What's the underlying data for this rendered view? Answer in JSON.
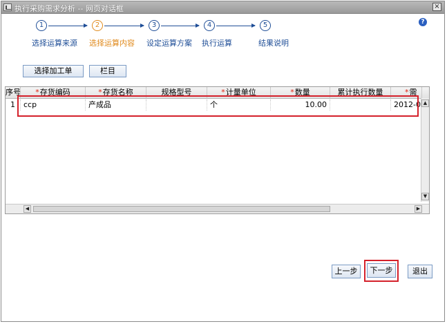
{
  "window": {
    "title": "执行采购需求分析 -- 网页对话框",
    "close_glyph": "×",
    "help_glyph": "?"
  },
  "steps": [
    {
      "number": "1",
      "label": "选择运算来源",
      "active": false
    },
    {
      "number": "2",
      "label": "选择运算内容",
      "active": true
    },
    {
      "number": "3",
      "label": "设定运算方案",
      "active": false
    },
    {
      "number": "4",
      "label": "执行运算",
      "active": false
    },
    {
      "number": "5",
      "label": "结果说明",
      "active": false
    }
  ],
  "toolbar": {
    "select_workorder_label": "选择加工单",
    "columns_label": "栏目"
  },
  "grid": {
    "columns": [
      {
        "label": "序号",
        "required": false
      },
      {
        "label": "存货编码",
        "required": true
      },
      {
        "label": "存货名称",
        "required": true
      },
      {
        "label": "规格型号",
        "required": false
      },
      {
        "label": "计量单位",
        "required": true
      },
      {
        "label": "数量",
        "required": true
      },
      {
        "label": "累计执行数量",
        "required": false
      },
      {
        "label": "需",
        "required": true
      }
    ],
    "rows": [
      {
        "seq": "1",
        "code": "ccp",
        "name": "产成品",
        "spec": "",
        "unit": "个",
        "qty": "10.00",
        "executed": "",
        "date": "2012-0"
      }
    ],
    "required_mark": "*",
    "scroll_up": "▲",
    "scroll_down": "▼",
    "scroll_left": "◀",
    "scroll_right": "▶"
  },
  "footer": {
    "prev_label": "上一步",
    "next_label": "下一步",
    "exit_label": "退出"
  },
  "colors": {
    "highlight": "#d4202a",
    "active_step": "#e08a1c",
    "step": "#1f4e97"
  }
}
